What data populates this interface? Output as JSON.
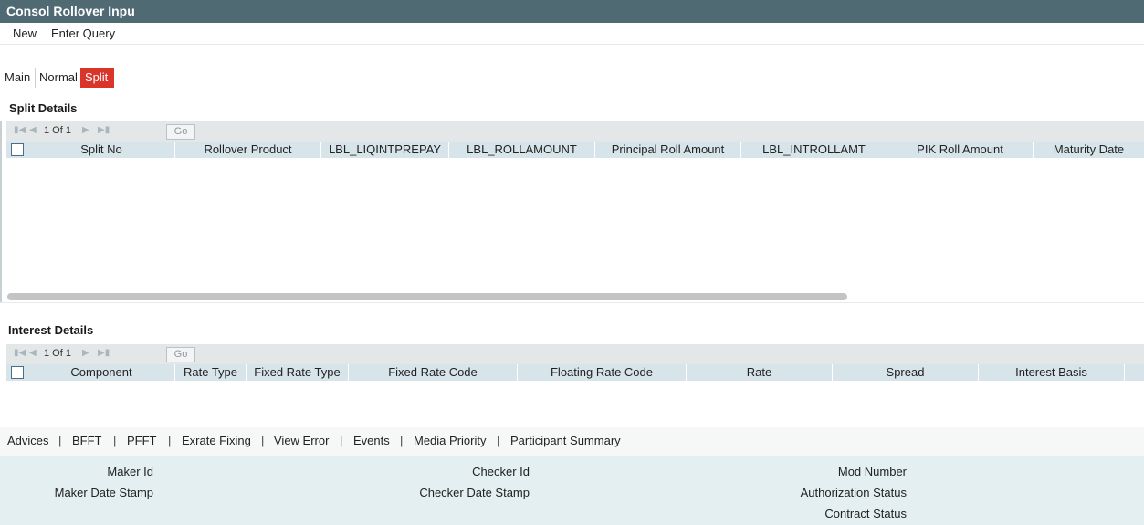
{
  "window": {
    "title": "Consol Rollover Inpu"
  },
  "menu": {
    "new_label": "New",
    "enter_query_label": "Enter Query"
  },
  "tabs": [
    {
      "label": "Main"
    },
    {
      "label": "Normal"
    },
    {
      "label": "Split",
      "active": true
    }
  ],
  "split_details": {
    "title": "Split Details",
    "pager": {
      "page_info": "1 Of 1",
      "go_label": "Go"
    },
    "columns": [
      "Split No",
      "Rollover Product",
      "LBL_LIQINTPREPAY",
      "LBL_ROLLAMOUNT",
      "Principal Roll Amount",
      "LBL_INTROLLAMT",
      "PIK Roll Amount",
      "Maturity Date"
    ],
    "rows": []
  },
  "interest_details": {
    "title": "Interest Details",
    "pager": {
      "page_info": "1 Of 1",
      "go_label": "Go"
    },
    "columns": [
      "Component",
      "Rate Type",
      "Fixed Rate Type",
      "Fixed Rate Code",
      "Floating Rate Code",
      "Rate",
      "Spread",
      "Interest Basis"
    ],
    "rows": []
  },
  "footer_links": [
    "Advices",
    "BFFT",
    "PFFT",
    "Exrate Fixing",
    "View Error",
    "Events",
    "Media Priority",
    "Participant Summary"
  ],
  "footer_separator": "|",
  "audit": {
    "maker_id": "Maker Id",
    "maker_date_stamp": "Maker Date Stamp",
    "checker_id": "Checker Id",
    "checker_date_stamp": "Checker Date Stamp",
    "mod_number": "Mod Number",
    "authorization_status": "Authorization Status",
    "contract_status": "Contract Status"
  },
  "colors": {
    "titlebar": "#4f6a73",
    "active_tab": "#d9352a",
    "grid_header": "#d7e5ea",
    "pager_bg": "#e4e7e8",
    "audit_bg": "#e3eff0"
  }
}
